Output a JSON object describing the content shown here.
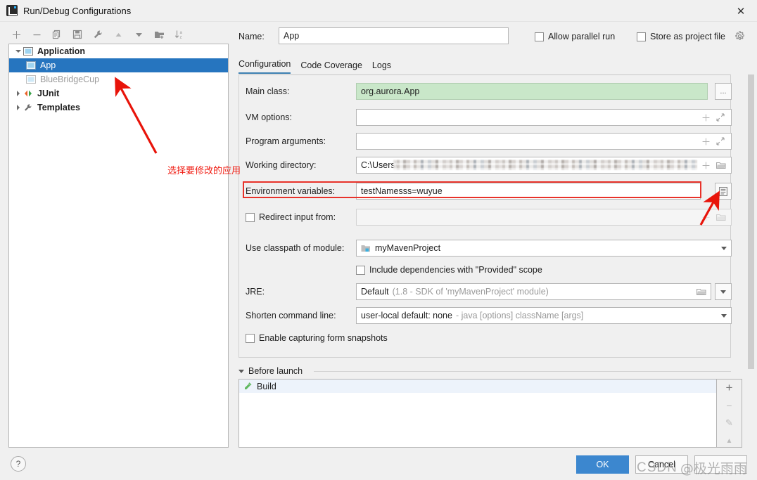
{
  "window": {
    "title": "Run/Debug Configurations",
    "close_label": "✕",
    "app_icon": "intellij-idea-logo"
  },
  "toolbar": {
    "items": [
      {
        "name": "add-configuration-button",
        "icon": "plus-icon",
        "label": "+"
      },
      {
        "name": "remove-configuration-button",
        "icon": "minus-icon",
        "label": "−"
      },
      {
        "name": "copy-configuration-button",
        "icon": "copy-icon",
        "label": "Copy"
      },
      {
        "name": "save-configuration-button",
        "icon": "save-icon",
        "label": "Save"
      },
      {
        "name": "edit-templates-button",
        "icon": "wrench-icon",
        "label": "Edit Templates"
      },
      {
        "name": "move-up-button",
        "icon": "triangle-up-icon",
        "label": "Move Up"
      },
      {
        "name": "move-down-button",
        "icon": "triangle-down-icon",
        "label": "Move Down"
      },
      {
        "name": "create-folder-button",
        "icon": "folder-add-icon",
        "label": "Create Folder"
      },
      {
        "name": "sort-configurations-button",
        "icon": "sort-az-icon",
        "label": "Sort Configurations"
      }
    ]
  },
  "tree": {
    "nodes": [
      {
        "label": "Application",
        "icon": "application-icon",
        "level": 0,
        "expanded": true,
        "bold": true,
        "selected": false,
        "dim": false
      },
      {
        "label": "App",
        "icon": "application-icon",
        "level": 1,
        "expanded": null,
        "bold": false,
        "selected": true,
        "dim": false
      },
      {
        "label": "BlueBridgeCup",
        "icon": "application-icon",
        "level": 1,
        "expanded": null,
        "bold": false,
        "selected": false,
        "dim": true
      },
      {
        "label": "JUnit",
        "icon": "junit-icon",
        "level": 0,
        "expanded": false,
        "bold": true,
        "selected": false,
        "dim": false
      },
      {
        "label": "Templates",
        "icon": "wrench-icon",
        "level": 0,
        "expanded": false,
        "bold": true,
        "selected": false,
        "dim": false
      }
    ]
  },
  "header": {
    "name_label": "Name:",
    "name_value": "App",
    "allow_parallel_run": "Allow parallel run",
    "allow_parallel_run_checked": false,
    "store_as_project_file": "Store as project file",
    "store_as_project_file_checked": false,
    "gear_icon": "gear-icon"
  },
  "tabs": [
    {
      "label": "Configuration",
      "active": true
    },
    {
      "label": "Code Coverage",
      "active": false
    },
    {
      "label": "Logs",
      "active": false
    }
  ],
  "form": {
    "main_class_label": "Main class:",
    "main_class_value": "org.aurora.App",
    "main_class_browse": "...",
    "vm_options_label": "VM options:",
    "vm_options_value": "",
    "program_arguments_label": "Program arguments:",
    "program_arguments_value": "",
    "working_directory_label": "Working directory:",
    "working_directory_value": "C:\\Users\\",
    "environment_variables_label": "Environment variables:",
    "environment_variables_value": "testNamesss=wuyue",
    "redirect_input_label": "Redirect input from:",
    "redirect_input_checked": false,
    "redirect_input_value": "",
    "use_classpath_label": "Use classpath of module:",
    "use_classpath_value": "myMavenProject",
    "include_dependencies_label": "Include dependencies with \"Provided\" scope",
    "include_dependencies_checked": false,
    "jre_label": "JRE:",
    "jre_value": "Default",
    "jre_value_hint": "(1.8 - SDK of 'myMavenProject' module)",
    "shorten_command_label": "Shorten command line:",
    "shorten_command_value": "user-local default: none",
    "shorten_command_hint": "- java [options] className [args]",
    "enable_snapshots_label": "Enable capturing form snapshots",
    "enable_snapshots_checked": false
  },
  "before_launch": {
    "title": "Before launch",
    "items": [
      {
        "label": "Build",
        "icon": "build-hammer-icon"
      }
    ],
    "side_buttons": [
      {
        "name": "add-task-button",
        "label": "+"
      },
      {
        "name": "remove-task-button",
        "label": "−"
      },
      {
        "name": "edit-task-button",
        "label": "✎"
      },
      {
        "name": "move-task-up-button",
        "label": "▲"
      }
    ]
  },
  "footer": {
    "help_label": "?",
    "ok_label": "OK",
    "cancel_label": "Cancel",
    "extra_label": ""
  },
  "annotations": {
    "note_text": "选择要修改的应用",
    "note_color": "#f01e14",
    "highlight_color": "#e8322a"
  },
  "watermark": {
    "site": "CSDN",
    "user": "@极光雨雨"
  },
  "colors": {
    "accent": "#2675bf",
    "ok_button": "#3c87cf",
    "main_class_bg": "#c9e7c9",
    "tab_underline": "#3c7fb1"
  }
}
